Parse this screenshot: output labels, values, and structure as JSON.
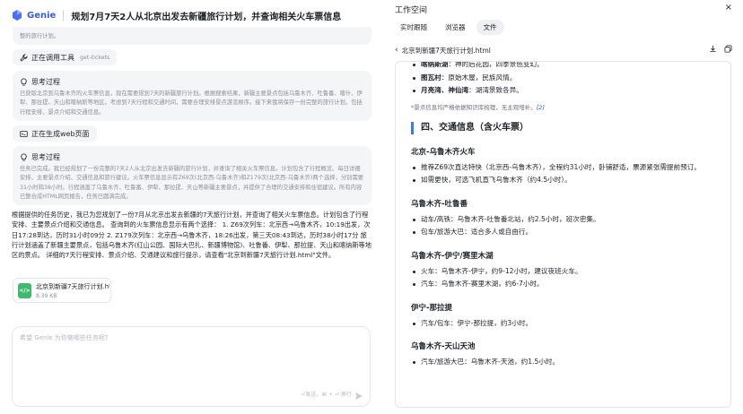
{
  "app": {
    "logo_text": "Genie",
    "chat_title": "规划7月7天2人从北京出发去新疆旅行计划，并查询相关火车票信息"
  },
  "chat": {
    "prev_think_tail": "整的旅行计划。",
    "tool_call": {
      "label": "正在调用工具",
      "tool": "get-tickets"
    },
    "think1": {
      "title": "思考过程",
      "text": "已获取北京到乌鲁木齐的火车票信息，现在需要规划7天的新疆旅行计划。根据搜索结果，新疆主要景点包括乌鲁木齐、吐鲁番、喀什、伊犁、那拉提、天山和喀纳斯等地区。考虑到7天行程和交通时间，需要合理安排景点游览顺序。接下来我将保存一份完整的旅行计划，包括行程安排、景点介绍和交通信息。"
    },
    "web_gen": {
      "label": "正在生成web页面"
    },
    "think2": {
      "title": "思考过程",
      "text": "任务已完成。我已经规划了一份完整的7天2人从北京出发去新疆的旅行计划，并查询了相关火车票信息。计划包含了行程概览、每日详细安排、主要景点介绍、交通信息和旅行建议。火车票信息显示有Z69次(北京西-乌鲁木齐)和Z179次(北京西-乌鲁木齐)两个选择，分别需要31小时和38小时。行程涵盖了乌鲁木齐、吐鲁番、伊犁、那拉提、天山等新疆主要景点，并提供了合理的交通安排和住宿建议。所有内容已整合成HTML网页报告，任务已圆满完成。"
    },
    "answer": "根据提供的任务历史，我已为您规划了一份7月从北京出发去新疆的7天旅行计划，并查询了相关火车票信息。计划包含了行程安排、主要景点介绍和交通信息。 查询到的火车票信息显示有两个选择： 1. Z69次列车：北京西→乌鲁木齐，10:19出发，次日17:28到达，历时31小时09分 2. Z179次列车：北京西→乌鲁木齐，18:26出发，第三天08:43到达，历时38小时17分 旅行计划涵盖了新疆主要景点，包括乌鲁木齐(红山公园、国际大巴扎、新疆博物馆)、吐鲁番、伊犁、那拉提、天山和喀纳斯等地区的景点。 详细的7天行程安排、景点介绍、交通建议和旅行提示，请查看\"北京到新疆7天旅行计划.html\"文件。",
    "file": {
      "name": "北京到新疆7天旅行计划.html",
      "size": "8.39 KB"
    },
    "input": {
      "placeholder": "希望 Genie 为你做哪些任务呢?",
      "hint": "⏎发送，⌘ + ⏎ 换行"
    }
  },
  "workspace": {
    "title": "工作空间",
    "close": "×",
    "tabs": [
      {
        "label": "实时跟随"
      },
      {
        "label": "浏览器"
      },
      {
        "label": "文件"
      }
    ],
    "file_path": "北京到新疆7天旅行计划.html",
    "doc": {
      "top_bullets": [
        {
          "bold": "喀纳斯湖",
          "text": "：神的后花园，四季景色变幻。"
        },
        {
          "bold": "图瓦村",
          "text": "：原始木屋，民族风情。"
        },
        {
          "bold": "月亮湾、神仙湾",
          "text": "：湖湾景致各异。"
        }
      ],
      "note": "*景点信息均严格依据知识库梳理，无主观增补。",
      "note_ref": "[2]",
      "section_title": "四、交通信息（含火车票）",
      "routes": [
        {
          "title": "北京-乌鲁木齐火车",
          "items": [
            "推荐Z69次直达特快（北京西-乌鲁木齐），全程约31小时，卧铺舒适，票源紧张需提前预订。",
            "如需更快，可选飞机直飞乌鲁木齐（约4.5小时）。"
          ]
        },
        {
          "title": "乌鲁木齐-吐鲁番",
          "items": [
            "动车/高铁：乌鲁木齐-吐鲁番北站，约2.5小时，班次密集。",
            "包车/旅游大巴：适合多人或自由行。"
          ]
        },
        {
          "title": "乌鲁木齐-伊宁/赛里木湖",
          "items": [
            "火车：乌鲁木齐-伊宁，约9-12小时，建议夜班火车。",
            "汽车：乌鲁木齐-赛里木湖，约6-7小时。"
          ]
        },
        {
          "title": "伊宁-那拉提",
          "items": [
            "汽车/包车：伊宁-那拉提，约3小时。"
          ]
        },
        {
          "title": "乌鲁木齐-天山天池",
          "items": [
            "汽车/旅游大巴：乌鲁木齐-天池，约1.5小时。"
          ]
        }
      ]
    }
  },
  "colors": {
    "accent": "#3b5bdb",
    "section_bar": "#3b7ddd",
    "block_bg": "#f4f5f7",
    "file_icon": "#3fb96f"
  }
}
